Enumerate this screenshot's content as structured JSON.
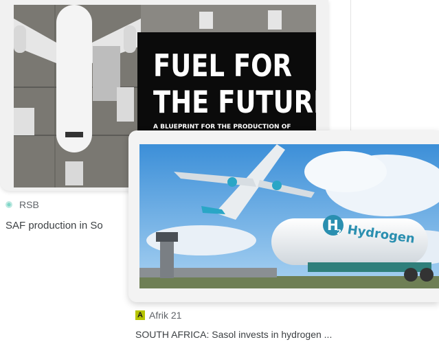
{
  "cards": [
    {
      "source": "RSB",
      "title": "SAF production in So",
      "image_text": {
        "headline_1": "FUEL FOR",
        "headline_2": "THE FUTURE",
        "subhead": "A BLUEPRINT FOR THE PRODUCTION OF"
      }
    },
    {
      "source": "Afrik 21",
      "title": "SOUTH AFRICA: Sasol invests in hydrogen ...",
      "image_text": {
        "h2_label": "H",
        "h2_sub": "2",
        "tank_label": "Hydrogen"
      }
    }
  ],
  "colors": {
    "rsb_favicon": "#7fd6c8",
    "afrik_favicon": "#b6c400",
    "source_text": "#5f6368",
    "title_text": "#3c4043"
  }
}
